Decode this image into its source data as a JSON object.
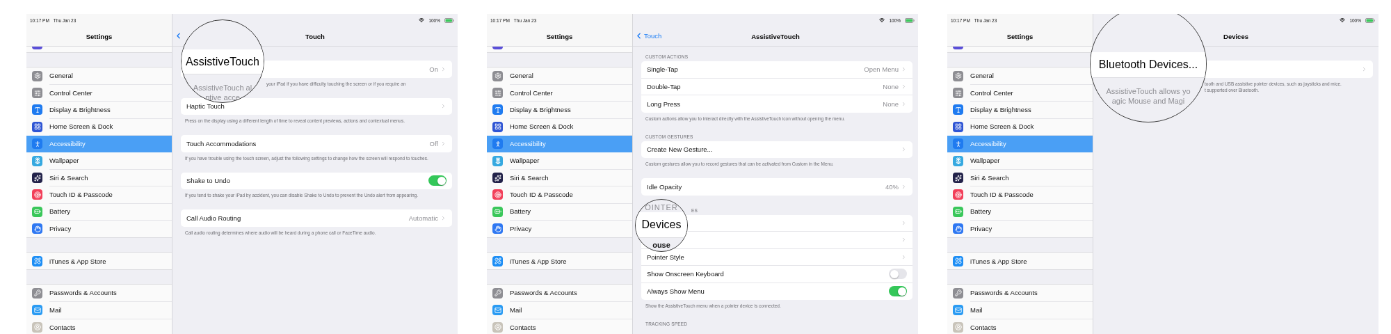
{
  "panels": [
    {
      "status_bar": {
        "time": "10:17 PM",
        "date": "Thu Jan 23",
        "battery": "100%"
      },
      "sidebar": {
        "title": "Settings",
        "groups": [
          [
            {
              "label": "General",
              "color": "#8e8e93",
              "selected": false
            },
            {
              "label": "Control Center",
              "color": "#8e8e93",
              "selected": false
            },
            {
              "label": "Display & Brightness",
              "color": "#1f7bf0",
              "selected": false
            },
            {
              "label": "Home Screen & Dock",
              "color": "#2f55d4",
              "selected": false
            },
            {
              "label": "Accessibility",
              "color": "#1f7bf0",
              "selected": true
            },
            {
              "label": "Wallpaper",
              "color": "#36a9e0",
              "selected": false
            },
            {
              "label": "Siri & Search",
              "color": "#23234a",
              "selected": false
            },
            {
              "label": "Touch ID & Passcode",
              "color": "#f2405a",
              "selected": false
            },
            {
              "label": "Battery",
              "color": "#3ac75a",
              "selected": false
            },
            {
              "label": "Privacy",
              "color": "#2f78f2",
              "selected": false
            }
          ],
          [
            {
              "label": "iTunes & App Store",
              "color": "#1d8ef5",
              "selected": false
            }
          ],
          [
            {
              "label": "Passwords & Accounts",
              "color": "#8e8e93",
              "selected": false
            },
            {
              "label": "Mail",
              "color": "#2a9bf3",
              "selected": false
            },
            {
              "label": "Contacts",
              "color": "#c9c4ba",
              "selected": false
            }
          ]
        ]
      },
      "detail": {
        "title": "Touch",
        "back": {
          "chevron": true
        },
        "sections": [
          {
            "rows": [
              {
                "kind": "link",
                "value": "On"
              }
            ],
            "footnote": "your iPad if you have difficulty touching the screen or if you require an",
            "footnote_covered": true
          },
          {
            "rows": [
              {
                "kind": "link",
                "label": "Haptic Touch"
              }
            ],
            "footnote": "Press on the display using a different length of time to reveal content previews, actions and contextual menus."
          },
          {
            "rows": [
              {
                "kind": "link",
                "label": "Touch Accommodations",
                "value": "Off"
              }
            ],
            "footnote": "If you have trouble using the touch screen, adjust the following settings to change how the screen will respond to touches."
          },
          {
            "rows": [
              {
                "kind": "toggle",
                "label": "Shake to Undo",
                "on": true
              }
            ],
            "footnote": "If you tend to shake your iPad by accident, you can disable Shake to Undo to prevent the Undo alert from appearing."
          },
          {
            "rows": [
              {
                "kind": "link",
                "label": "Call Audio Routing",
                "value": "Automatic"
              }
            ],
            "footnote": "Call audio routing determines where audio will be heard during a phone call or FaceTime audio."
          }
        ]
      },
      "magnifier": {
        "lines": [
          {
            "kind": "label",
            "text": "AssistiveTouch"
          },
          {
            "kind": "note",
            "text": "AssistiveTouch al"
          },
          {
            "kind": "note",
            "text": "ptive acce"
          }
        ]
      }
    },
    {
      "status_bar": {
        "time": "10:17 PM",
        "date": "Thu Jan 23",
        "battery": "100%"
      },
      "sidebar": {
        "title": "Settings",
        "groups": [
          [
            {
              "label": "General",
              "color": "#8e8e93",
              "selected": false
            },
            {
              "label": "Control Center",
              "color": "#8e8e93",
              "selected": false
            },
            {
              "label": "Display & Brightness",
              "color": "#1f7bf0",
              "selected": false
            },
            {
              "label": "Home Screen & Dock",
              "color": "#2f55d4",
              "selected": false
            },
            {
              "label": "Accessibility",
              "color": "#1f7bf0",
              "selected": true
            },
            {
              "label": "Wallpaper",
              "color": "#36a9e0",
              "selected": false
            },
            {
              "label": "Siri & Search",
              "color": "#23234a",
              "selected": false
            },
            {
              "label": "Touch ID & Passcode",
              "color": "#f2405a",
              "selected": false
            },
            {
              "label": "Battery",
              "color": "#3ac75a",
              "selected": false
            },
            {
              "label": "Privacy",
              "color": "#2f78f2",
              "selected": false
            }
          ],
          [
            {
              "label": "iTunes & App Store",
              "color": "#1d8ef5",
              "selected": false
            }
          ],
          [
            {
              "label": "Passwords & Accounts",
              "color": "#8e8e93",
              "selected": false
            },
            {
              "label": "Mail",
              "color": "#2a9bf3",
              "selected": false
            },
            {
              "label": "Contacts",
              "color": "#c9c4ba",
              "selected": false
            }
          ]
        ]
      },
      "detail": {
        "title": "AssistiveTouch",
        "back": {
          "chevron": true,
          "label": "Touch",
          "covered": false
        },
        "sections": [
          {
            "header": "CUSTOM ACTIONS",
            "rows": [
              {
                "kind": "link",
                "label": "Single-Tap",
                "value": "Open Menu"
              },
              {
                "kind": "link",
                "label": "Double-Tap",
                "value": "None"
              },
              {
                "kind": "link",
                "label": "Long Press",
                "value": "None"
              }
            ],
            "footnote": "Custom actions allow you to interact directly with the AssistiveTouch icon without opening the menu."
          },
          {
            "header": "CUSTOM GESTURES",
            "rows": [
              {
                "kind": "link",
                "label": "Create New Gesture..."
              }
            ],
            "footnote": "Custom gestures allow you to record gestures that can be activated from Custom in the Menu."
          },
          {
            "rows": [
              {
                "kind": "link",
                "label": "Idle Opacity",
                "value": "40%"
              }
            ]
          },
          {
            "header": "ES",
            "header_covered": true,
            "rows": [
              {
                "kind": "link"
              },
              {
                "kind": "link"
              },
              {
                "kind": "link",
                "label": "Pointer Style"
              },
              {
                "kind": "toggle",
                "label": "Show Onscreen Keyboard",
                "on": false
              },
              {
                "kind": "toggle",
                "label": "Always Show Menu",
                "on": true
              }
            ],
            "footnote": "Show the AssistiveTouch menu when a pointer device is connected."
          },
          {
            "header": "TRACKING SPEED"
          }
        ]
      },
      "magnifier": {
        "lines": [
          {
            "kind": "header",
            "text": "OINTER"
          },
          {
            "kind": "label",
            "text": "Devices"
          },
          {
            "kind": "cut",
            "text": "ouse"
          }
        ]
      }
    },
    {
      "status_bar": {
        "time": "10:17 PM",
        "date": "Thu Jan 23",
        "battery": "100%"
      },
      "sidebar": {
        "title": "Settings",
        "groups": [
          [
            {
              "label": "General",
              "color": "#8e8e93",
              "selected": false
            },
            {
              "label": "Control Center",
              "color": "#8e8e93",
              "selected": false
            },
            {
              "label": "Display & Brightness",
              "color": "#1f7bf0",
              "selected": false
            },
            {
              "label": "Home Screen & Dock",
              "color": "#2f55d4",
              "selected": false
            },
            {
              "label": "Accessibility",
              "color": "#1f7bf0",
              "selected": true
            },
            {
              "label": "Wallpaper",
              "color": "#36a9e0",
              "selected": false
            },
            {
              "label": "Siri & Search",
              "color": "#23234a",
              "selected": false
            },
            {
              "label": "Touch ID & Passcode",
              "color": "#f2405a",
              "selected": false
            },
            {
              "label": "Battery",
              "color": "#3ac75a",
              "selected": false
            },
            {
              "label": "Privacy",
              "color": "#2f78f2",
              "selected": false
            }
          ],
          [
            {
              "label": "iTunes & App Store",
              "color": "#1d8ef5",
              "selected": false
            }
          ],
          [
            {
              "label": "Passwords & Accounts",
              "color": "#8e8e93",
              "selected": false
            },
            {
              "label": "Mail",
              "color": "#2a9bf3",
              "selected": false
            },
            {
              "label": "Contacts",
              "color": "#c9c4ba",
              "selected": false
            }
          ]
        ]
      },
      "detail": {
        "title": "Devices",
        "sections": [
          {
            "rows": [
              {
                "kind": "link"
              }
            ],
            "footnote": "tooth and USB assistive pointer devices, such as joysticks and mice.\nt supported over Bluetooth.",
            "footnote_covered": true
          }
        ]
      },
      "magnifier": {
        "lines": [
          {
            "kind": "label",
            "text": "Bluetooth Devices..."
          },
          {
            "kind": "note",
            "text": "AssistiveTouch allows yo"
          },
          {
            "kind": "note",
            "text": "agic Mouse and Magi"
          }
        ]
      }
    }
  ]
}
